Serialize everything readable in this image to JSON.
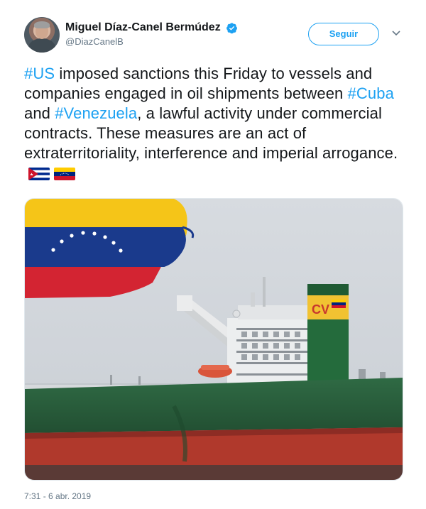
{
  "author": {
    "display_name": "Miguel Díaz-Canel Bermúdez",
    "handle": "@DiazCanelB",
    "verified": true,
    "avatar_icon": "profile-photo"
  },
  "follow_button": {
    "label": "Seguir",
    "color": "#1da1f2"
  },
  "menu_icon": "chevron-down-icon",
  "tweet": {
    "segments": [
      {
        "text": "#US",
        "hashtag": true
      },
      {
        "text": " imposed sanctions this Friday to vessels and companies engaged in oil shipments between ",
        "hashtag": false
      },
      {
        "text": "#Cuba",
        "hashtag": true
      },
      {
        "text": " and ",
        "hashtag": false
      },
      {
        "text": "#Venezuela",
        "hashtag": true
      },
      {
        "text": ", a lawful activity under commercial contracts. These measures are an act of extraterritoriality, interference and imperial arrogance.",
        "hashtag": false
      }
    ],
    "emojis": [
      "cuba-flag-emoji",
      "venezuela-flag-emoji"
    ]
  },
  "media": {
    "description_icon": "oil-tanker-photo",
    "funnel_text": "CV"
  },
  "timestamp": "7:31 - 6 abr. 2019",
  "colors": {
    "hashtag": "#1da1f2",
    "text": "#14171a",
    "secondary": "#657786"
  }
}
